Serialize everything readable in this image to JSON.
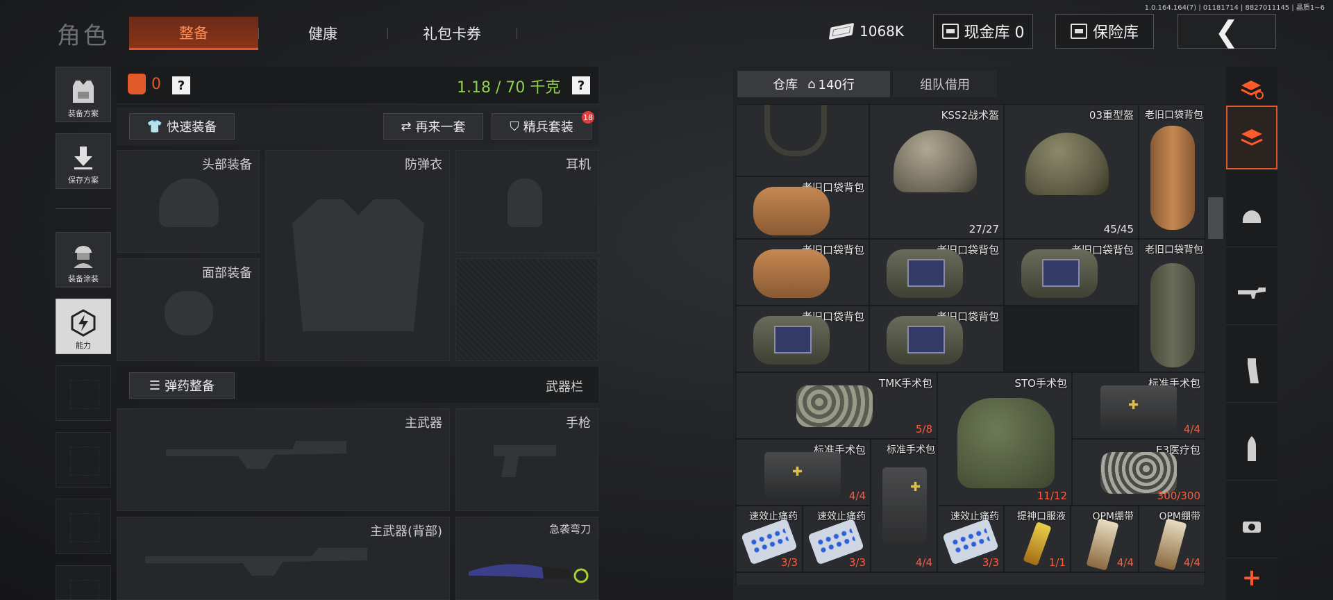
{
  "version": "1.0.164.164(7) | 01181714 | 8827011145 | 晶质1~6",
  "page_title": "角色",
  "tabs": [
    {
      "label": "整备",
      "active": true
    },
    {
      "label": "健康",
      "active": false
    },
    {
      "label": "礼包卡券",
      "active": false
    }
  ],
  "top_right": {
    "money": "1068K",
    "cash_vault": "现金库 0",
    "insurance_vault": "保险库"
  },
  "sidebar": [
    {
      "label": "装备方案",
      "icon": "vest-icon"
    },
    {
      "label": "保存方案",
      "icon": "download-icon"
    },
    {
      "label": "装备涂装",
      "icon": "soldier-icon"
    },
    {
      "label": "能力",
      "icon": "lightning-hex-icon",
      "active": true
    }
  ],
  "equip": {
    "armor_count": "0",
    "help": "?",
    "weight": "1.18 / 70 千克",
    "quick_equip": "快速装备",
    "again_set": "再来一套",
    "elite_set": "精兵套装",
    "elite_badge": "18",
    "slots": {
      "head": "头部装备",
      "body_armor": "防弹衣",
      "headset": "耳机",
      "face": "面部装备",
      "primary": "主武器",
      "pistol": "手枪",
      "primary_back": "主武器(背部)",
      "melee": "急袭弯刀"
    },
    "ammo_equip": "弹药整备",
    "weapon_bar": "武器栏"
  },
  "warehouse": {
    "tab_main": "仓库",
    "rows": "140行",
    "tab_team": "组队借用",
    "items": [
      {
        "name": "KSS2战术盔",
        "count": "27/27"
      },
      {
        "name": "03重型盔",
        "count": "45/45"
      },
      {
        "name": "老旧口袋背包",
        "count": ""
      },
      {
        "name": "TMK手术包",
        "count": "5/8"
      },
      {
        "name": "STO手术包",
        "count": "11/12"
      },
      {
        "name": "标准手术包",
        "count": "4/4"
      },
      {
        "name": "E3医疗包",
        "count": "300/300"
      },
      {
        "name": "速效止痛药",
        "count": "3/3"
      },
      {
        "name": "提神口服液",
        "count": "1/1"
      },
      {
        "name": "OPM绷带",
        "count": "4/4"
      }
    ]
  },
  "right_strip": [
    {
      "icon": "stack-refresh-icon"
    },
    {
      "icon": "stack-icon",
      "active": true
    },
    {
      "icon": "helmet-icon"
    },
    {
      "icon": "rifle-icon"
    },
    {
      "icon": "magazine-icon"
    },
    {
      "icon": "bullet-icon"
    },
    {
      "icon": "scope-icon"
    },
    {
      "icon": "plus-icon"
    }
  ]
}
